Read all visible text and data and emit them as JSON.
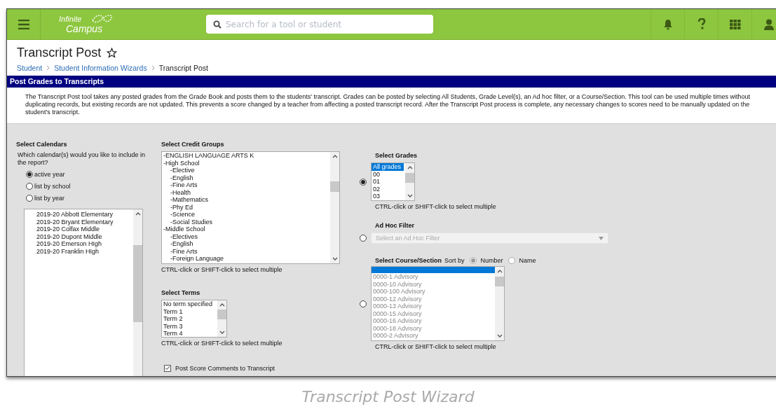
{
  "header": {
    "logo": {
      "line_1": "Infinite",
      "line_2": "Campus"
    },
    "search": {
      "placeholder": "Search for a tool or student"
    }
  },
  "page": {
    "title": "Transcript Post",
    "favorite": false,
    "breadcrumbs": [
      "Student",
      "Student Information Wizards",
      "Transcript Post"
    ]
  },
  "section": {
    "title": "Post Grades to Transcripts",
    "description": "The Transcript Post tool takes any posted grades from the Grade Book and posts them to the students' transcript. Grades can be posted by selecting All Students, Grade Level(s), an Ad hoc filter, or a Course/Section. This tool can be used multiple times without duplicating records, but existing records are not updated. This prevents a score changed by a teacher from affecting a posted transcript record. After the Transcript Post process is complete, any necessary changes to scores need to be manually updated on the student's transcript."
  },
  "calendars": {
    "title": "Select Calendars",
    "question": "Which calendar(s) would you like to include in the report?",
    "options": [
      {
        "label": "active year",
        "selected": true
      },
      {
        "label": "list by school",
        "selected": false
      },
      {
        "label": "list by year",
        "selected": false
      }
    ],
    "items": [
      "2019-20 Abbott Elementary",
      "2019-20 Bryant Elementary",
      "2019-20 Colfax Middle",
      "2019-20 Dupont Middle",
      "2019-20 Emerson HIgh",
      "2019-20 Franklin HIgh"
    ]
  },
  "credit_groups": {
    "title": "Select Credit Groups",
    "hint": "CTRL-click or SHIFT-click to select multiple",
    "items": [
      {
        "label": "-ENGLISH LANGUAGE ARTS K"
      },
      {
        "label": "-High School",
        "children": [
          {
            "label": "-Elective"
          },
          {
            "label": "-English"
          },
          {
            "label": "-Fine Arts"
          },
          {
            "label": "-Health"
          },
          {
            "label": "-Mathematics"
          },
          {
            "label": "-Phy Ed"
          },
          {
            "label": "-Science"
          },
          {
            "label": "-Social Studies"
          }
        ]
      },
      {
        "label": "-Middle School",
        "children": [
          {
            "label": "-Electives"
          },
          {
            "label": "-English"
          },
          {
            "label": "-Fine Arts"
          },
          {
            "label": "-Foreign Language"
          }
        ]
      }
    ]
  },
  "terms": {
    "title": "Select Terms",
    "hint": "CTRL-click or SHIFT-click to select multiple",
    "items": [
      "No term specified",
      "Term 1",
      "Term 2",
      "Term 3",
      "Term 4"
    ]
  },
  "post_comments": {
    "label": "Post Score Comments to Transcript",
    "checked": true
  },
  "filters": [
    {
      "kind": "grades",
      "selected": true,
      "title": "Select Grades",
      "hint": "CTRL-click or SHIFT-click to select multiple",
      "items": [
        {
          "label": "All grades",
          "selected": true
        },
        {
          "label": "00",
          "selected": false
        },
        {
          "label": "01",
          "selected": false
        },
        {
          "label": "02",
          "selected": false
        },
        {
          "label": "03",
          "selected": false
        }
      ]
    },
    {
      "kind": "adhoc",
      "selected": false,
      "title": "Ad Hoc Filter",
      "placeholder": "Select an Ad Hoc Filter"
    },
    {
      "kind": "course",
      "selected": false,
      "title": "Select Course/Section",
      "sort_label": "Sort by",
      "sort_options": [
        {
          "label": "Number",
          "selected": true
        },
        {
          "label": "Name",
          "selected": false
        }
      ],
      "highlighted_empty_row": true,
      "items": [
        "0000-1 Advisory",
        "0000-10 Advisory",
        "0000-100 Advisory",
        "0000-12 Advisory",
        "0000-13 Advisory",
        "0000-15 Advisory",
        "0000-16 Advisory",
        "0000-18 Advisory",
        "0000-2 Advisory"
      ],
      "hint": "CTRL-click or SHIFT-click to select multiple"
    }
  ],
  "caption": "Transcript Post Wizard"
}
